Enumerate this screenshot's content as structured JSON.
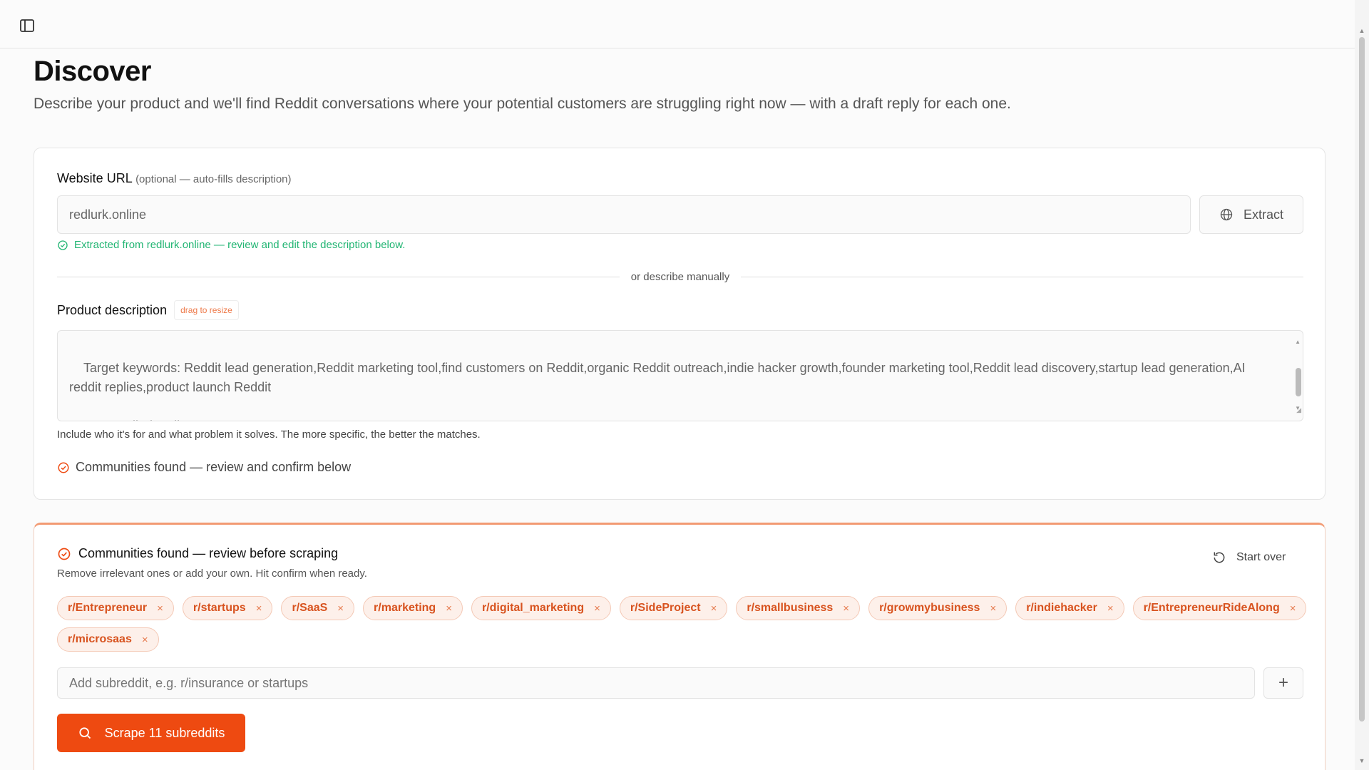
{
  "header": {
    "title": "Discover",
    "subtitle": "Describe your product and we'll find Reddit conversations where your potential customers are struggling right now — with a draft reply for each one."
  },
  "url_section": {
    "label": "Website URL",
    "hint": "(optional — auto-fills description)",
    "value": "redlurk.online",
    "extract_label": "Extract",
    "success_message": "Extracted from redlurk.online — review and edit the description below.",
    "divider_text": "or describe manually"
  },
  "description": {
    "label": "Product description",
    "resize_badge": "drag to resize",
    "value": "Target keywords: Reddit lead generation,Reddit marketing tool,find customers on Reddit,organic Reddit outreach,indie hacker growth,founder marketing tool,Reddit lead discovery,startup lead generation,AI reddit replies,product launch Reddit\n\nSource: redlurk.online",
    "help": "Include who it's for and what problem it solves. The more specific, the better the matches.",
    "status": "Communities found — review and confirm below"
  },
  "communities": {
    "title": "Communities found — review before scraping",
    "subtitle": "Remove irrelevant ones or add your own. Hit confirm when ready.",
    "start_over_label": "Start over",
    "chips": [
      "r/Entrepreneur",
      "r/startups",
      "r/SaaS",
      "r/marketing",
      "r/digital_marketing",
      "r/SideProject",
      "r/smallbusiness",
      "r/growmybusiness",
      "r/indiehacker",
      "r/EntrepreneurRideAlong",
      "r/microsaas"
    ],
    "chip_remove_symbol": "×",
    "add_placeholder": "Add subreddit, e.g. r/insurance or startups",
    "add_button_symbol": "+",
    "scrape_label": "Scrape 11 subreddits"
  },
  "icons": {
    "sidebar_toggle": "sidebar-icon",
    "extract": "globe-icon",
    "success": "check-circle-icon",
    "start_over": "refresh-icon",
    "scrape": "search-icon"
  },
  "colors": {
    "accent": "#ee4a11",
    "chip_text": "#d8531f",
    "chip_bg": "#fdf0ea",
    "success": "#22b573"
  }
}
